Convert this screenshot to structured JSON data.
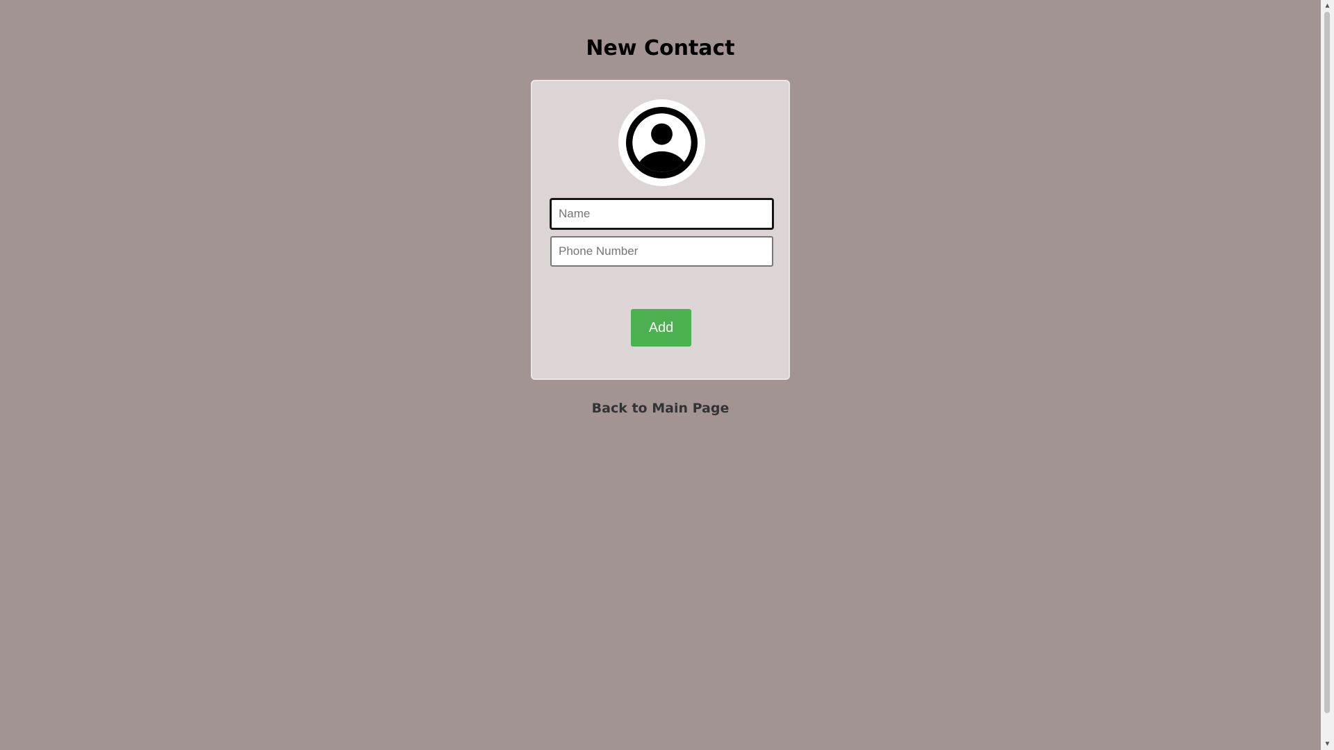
{
  "page": {
    "title": "New Contact"
  },
  "card": {
    "avatar_icon": "user-circle-icon",
    "name_field": {
      "value": "",
      "placeholder": "Name"
    },
    "phone_field": {
      "value": "",
      "placeholder": "Phone Number"
    },
    "add_label": "Add"
  },
  "back_link": {
    "label": "Back to Main Page"
  },
  "colors": {
    "background": "#a39494",
    "card": "#ddd5d5",
    "add_button": "#4caf50"
  }
}
